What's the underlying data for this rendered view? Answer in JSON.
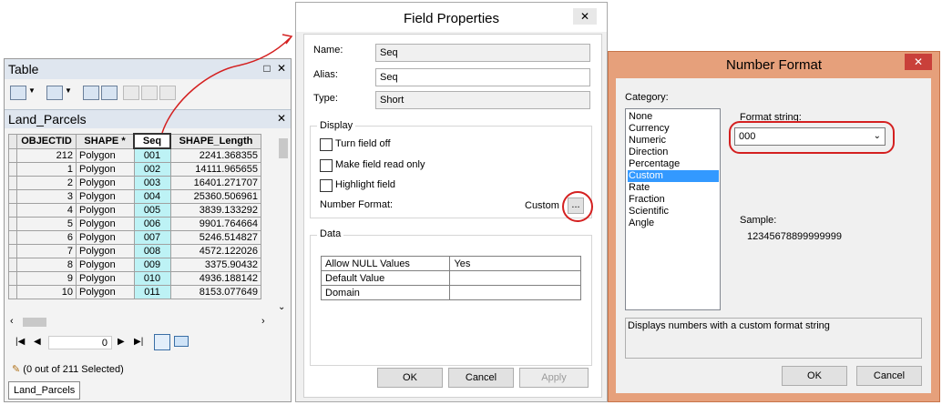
{
  "table_window": {
    "title": "Table",
    "layer_tab": "Land_Parcels",
    "columns": [
      "OBJECTID",
      "SHAPE *",
      "Seq",
      "SHAPE_Length"
    ],
    "rows": [
      [
        "212",
        "Polygon",
        "001",
        "2241.368355"
      ],
      [
        "1",
        "Polygon",
        "002",
        "14111.965655"
      ],
      [
        "2",
        "Polygon",
        "003",
        "16401.271707"
      ],
      [
        "3",
        "Polygon",
        "004",
        "25360.506961"
      ],
      [
        "4",
        "Polygon",
        "005",
        "3839.133292"
      ],
      [
        "5",
        "Polygon",
        "006",
        "9901.764664"
      ],
      [
        "6",
        "Polygon",
        "007",
        "5246.514827"
      ],
      [
        "7",
        "Polygon",
        "008",
        "4572.122026"
      ],
      [
        "8",
        "Polygon",
        "009",
        "3375.90432"
      ],
      [
        "9",
        "Polygon",
        "010",
        "4936.188142"
      ],
      [
        "10",
        "Polygon",
        "011",
        "8153.077649"
      ]
    ],
    "record_index": "0",
    "status": "(0 out of 211 Selected)",
    "bottom_tab": "Land_Parcels"
  },
  "field_properties": {
    "title": "Field Properties",
    "close_glyph": "✕",
    "name_label": "Name:",
    "name_value": "Seq",
    "alias_label": "Alias:",
    "alias_value": "Seq",
    "type_label": "Type:",
    "type_value": "Short",
    "display_group": "Display",
    "turn_off_label": "Turn field off",
    "read_only_label": "Make field read only",
    "highlight_label": "Highlight field",
    "number_format_label": "Number Format:",
    "number_format_value": "Custom",
    "ellipsis": "...",
    "data_group": "Data",
    "data_rows": [
      [
        "Allow NULL Values",
        "Yes"
      ],
      [
        "Default Value",
        ""
      ],
      [
        "Domain",
        ""
      ]
    ],
    "ok": "OK",
    "cancel": "Cancel",
    "apply": "Apply"
  },
  "number_format": {
    "title": "Number Format",
    "close_glyph": "✕",
    "category_label": "Category:",
    "categories": [
      "None",
      "Currency",
      "Numeric",
      "Direction",
      "Percentage",
      "Custom",
      "Rate",
      "Fraction",
      "Scientific",
      "Angle"
    ],
    "selected_category": "Custom",
    "format_string_label": "Format string:",
    "format_string_value": "000",
    "sample_label": "Sample:",
    "sample_value": "12345678899999999",
    "description": "Displays numbers with a custom format string",
    "ok": "OK",
    "cancel": "Cancel"
  },
  "colors": {
    "seq_column": "#bdf2f5",
    "selection": "#3399ff",
    "highlight_annotation": "#d42020",
    "number_format_frame": "#e6a07b"
  }
}
